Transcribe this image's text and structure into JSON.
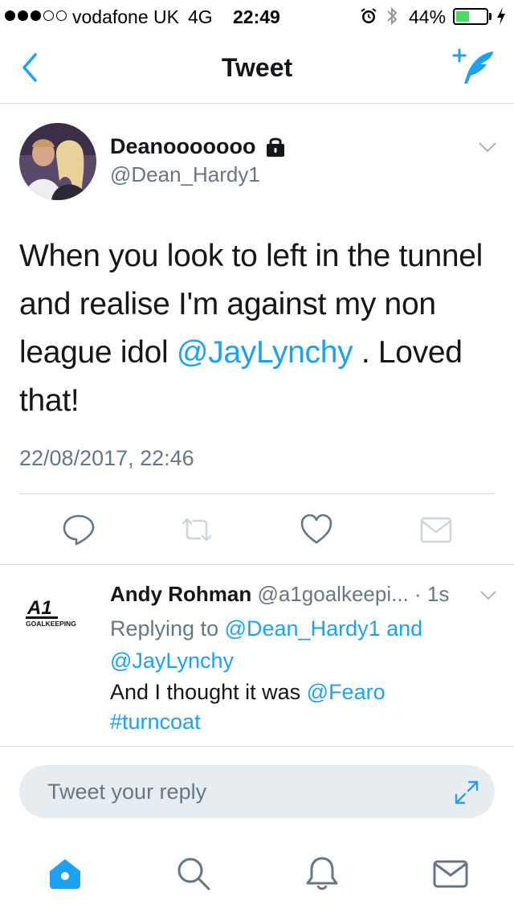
{
  "status_bar": {
    "carrier": "vodafone UK",
    "network": "4G",
    "time": "22:49",
    "battery_percent": "44%",
    "battery_level": 0.44,
    "icons": [
      "signal-dots",
      "alarm-icon",
      "bluetooth-icon",
      "battery-icon",
      "charging-icon"
    ]
  },
  "nav": {
    "title": "Tweet",
    "back_icon": "chevron-left-icon",
    "compose_icon": "compose-tweet-icon"
  },
  "tweet": {
    "author_name": "Deanooooooo",
    "author_handle": "@Dean_Hardy1",
    "text_before": "When you look to left in the tunnel and realise I'm against my non league idol ",
    "mention": "@JayLynchy",
    "text_after": " . Loved that!",
    "timestamp": "22/08/2017, 22:46",
    "actions": [
      "reply-icon",
      "retweet-icon",
      "like-icon",
      "direct-message-icon"
    ]
  },
  "reply": {
    "name": "Andy Rohman",
    "handle": "@a1goalkeepi...",
    "separator": " · ",
    "time": "1s",
    "avatar_logo_main": "A1",
    "avatar_logo_sub": "GOALKEEPING",
    "replying_to_label": "Replying to ",
    "replying_to_users": "@Dean_Hardy1 and @JayLynchy",
    "text_before": "And I thought it was ",
    "mention": "@Fearo",
    "hashtag": "#turncoat"
  },
  "composer": {
    "placeholder": "Tweet your reply"
  },
  "tab_bar": {
    "tabs": [
      "home-icon",
      "search-icon",
      "notifications-icon",
      "messages-icon"
    ]
  },
  "colors": {
    "accent": "#1da1f2",
    "text": "#14171a",
    "secondary": "#657786",
    "divider": "#d5d8db",
    "composer_bg": "#e6ecf0",
    "battery": "#4cd964"
  }
}
